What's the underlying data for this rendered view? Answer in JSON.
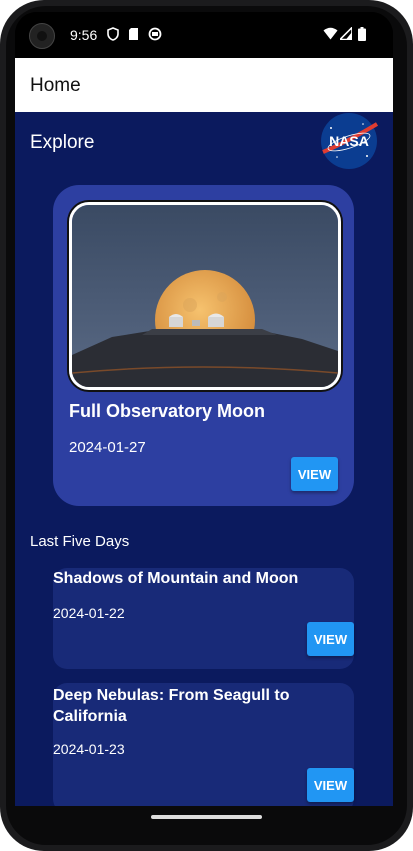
{
  "status_bar": {
    "time": "9:56",
    "left_icons": [
      "shield-icon",
      "sd-card-icon",
      "sync-icon"
    ],
    "right_icons": [
      "wifi-icon",
      "signal-icon",
      "battery-icon"
    ]
  },
  "app_bar": {
    "title": "Home"
  },
  "explore": {
    "title": "Explore",
    "logo": "NASA"
  },
  "featured": {
    "title": "Full Observatory Moon",
    "date": "2024-01-27",
    "button_label": "VIEW"
  },
  "last_five_days": {
    "label": "Last Five Days",
    "items": [
      {
        "title": "Shadows of Mountain and Moon",
        "date": "2024-01-22",
        "button_label": "VIEW"
      },
      {
        "title": "Deep Nebulas: From Seagull to California",
        "date": "2024-01-23",
        "button_label": "VIEW"
      }
    ]
  },
  "colors": {
    "content_bg": "#0b1a5e",
    "feature_card": "#2d3fa1",
    "list_card": "#182a78",
    "button": "#2196f3"
  }
}
